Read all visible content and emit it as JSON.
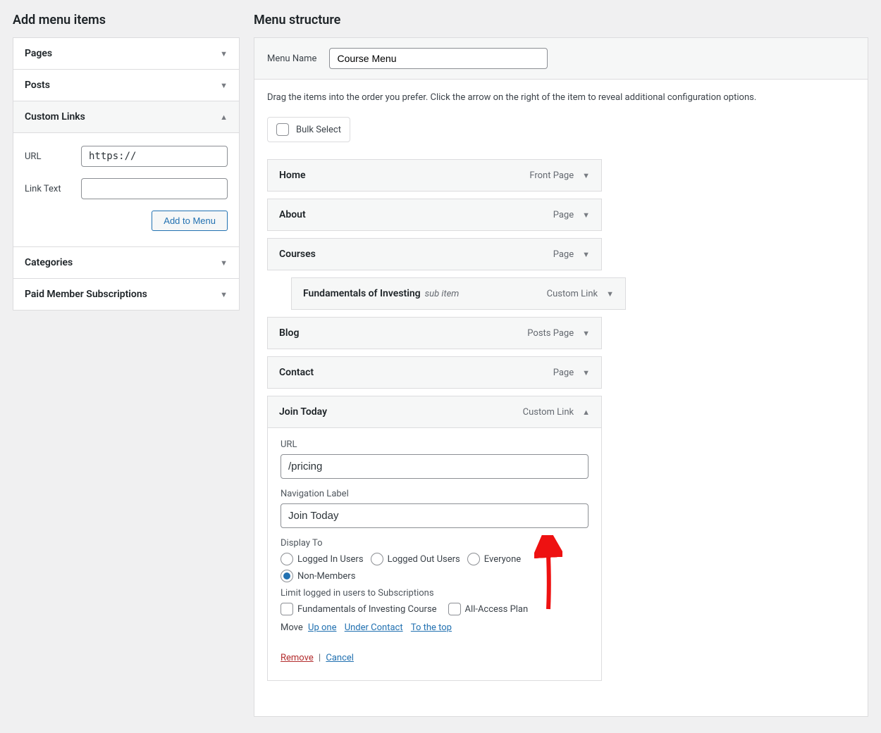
{
  "left": {
    "heading": "Add menu items",
    "pages": "Pages",
    "posts": "Posts",
    "custom_links": "Custom Links",
    "url_label": "URL",
    "url_value": "https://",
    "linktext_label": "Link Text",
    "linktext_value": "",
    "add_btn": "Add to Menu",
    "categories": "Categories",
    "pms": "Paid Member Subscriptions"
  },
  "right": {
    "heading": "Menu structure",
    "menu_name_label": "Menu Name",
    "menu_name_value": "Course Menu",
    "instructions": "Drag the items into the order you prefer. Click the arrow on the right of the item to reveal additional configuration options.",
    "bulk": "Bulk Select",
    "items": {
      "home": {
        "title": "Home",
        "type": "Front Page"
      },
      "about": {
        "title": "About",
        "type": "Page"
      },
      "courses": {
        "title": "Courses",
        "type": "Page"
      },
      "fund": {
        "title": "Fundamentals of Investing",
        "sub": "sub item",
        "type": "Custom Link"
      },
      "blog": {
        "title": "Blog",
        "type": "Posts Page"
      },
      "contact": {
        "title": "Contact",
        "type": "Page"
      },
      "join": {
        "title": "Join Today",
        "type": "Custom Link"
      }
    },
    "join_body": {
      "url_label": "URL",
      "url_value": "/pricing",
      "nav_label": "Navigation Label",
      "nav_value": "Join Today",
      "display_to": "Display To",
      "opt_logged_in": "Logged In Users",
      "opt_logged_out": "Logged Out Users",
      "opt_everyone": "Everyone",
      "opt_nonmembers": "Non-Members",
      "limit_label": "Limit logged in users to Subscriptions",
      "sub_fund": "Fundamentals of Investing Course",
      "sub_allaccess": "All-Access Plan",
      "move": "Move",
      "up_one": "Up one",
      "under_contact": "Under Contact",
      "to_top": "To the top",
      "remove": "Remove",
      "cancel": "Cancel"
    }
  }
}
